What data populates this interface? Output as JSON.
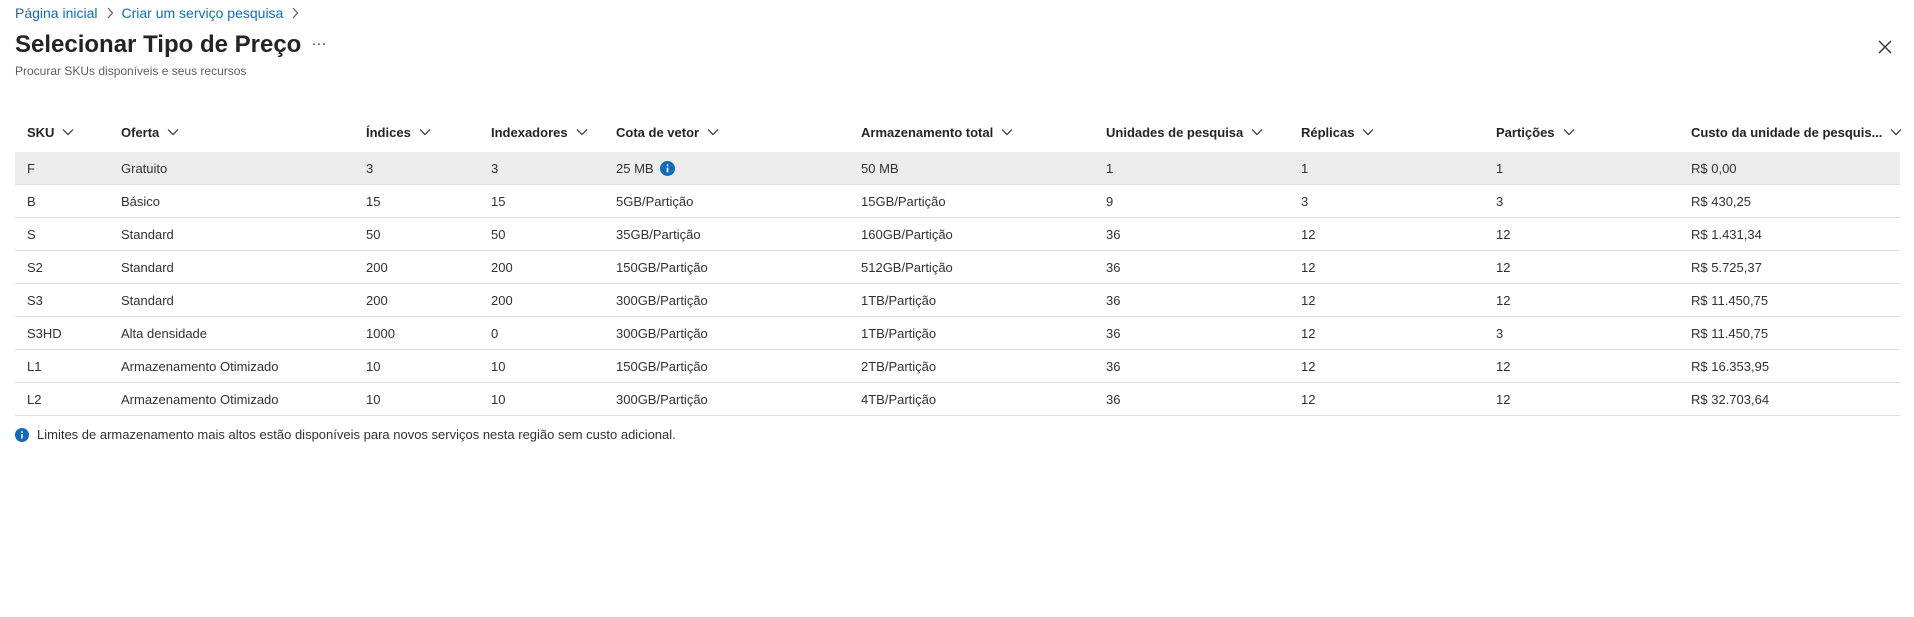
{
  "breadcrumb": {
    "items": [
      "Página inicial",
      "Criar um serviço pesquisa"
    ]
  },
  "header": {
    "title": "Selecionar Tipo de Preço",
    "more": "···",
    "subtitle": "Procurar SKUs disponíveis e seus recursos"
  },
  "table": {
    "columns": [
      "SKU",
      "Oferta",
      "Índices",
      "Indexadores",
      "Cota de vetor",
      "Armazenamento total",
      "Unidades de pesquisa",
      "Réplicas",
      "Partições",
      "Custo da unidade de pesquis..."
    ],
    "rows": [
      [
        "F",
        "Gratuito",
        "3",
        "3",
        "25 MB",
        "50 MB",
        "1",
        "1",
        "1",
        "R$ 0,00"
      ],
      [
        "B",
        "Básico",
        "15",
        "15",
        "5GB/Partição",
        "15GB/Partição",
        "9",
        "3",
        "3",
        "R$ 430,25"
      ],
      [
        "S",
        "Standard",
        "50",
        "50",
        "35GB/Partição",
        "160GB/Partição",
        "36",
        "12",
        "12",
        "R$ 1.431,34"
      ],
      [
        "S2",
        "Standard",
        "200",
        "200",
        "150GB/Partição",
        "512GB/Partição",
        "36",
        "12",
        "12",
        "R$ 5.725,37"
      ],
      [
        "S3",
        "Standard",
        "200",
        "200",
        "300GB/Partição",
        "1TB/Partição",
        "36",
        "12",
        "12",
        "R$ 11.450,75"
      ],
      [
        "S3HD",
        "Alta densidade",
        "1000",
        "0",
        "300GB/Partição",
        "1TB/Partição",
        "36",
        "12",
        "3",
        "R$ 11.450,75"
      ],
      [
        "L1",
        "Armazenamento Otimizado",
        "10",
        "10",
        "150GB/Partição",
        "2TB/Partição",
        "36",
        "12",
        "12",
        "R$ 16.353,95"
      ],
      [
        "L2",
        "Armazenamento Otimizado",
        "10",
        "10",
        "300GB/Partição",
        "4TB/Partição",
        "36",
        "12",
        "12",
        "R$ 32.703,64"
      ]
    ],
    "selected_row": 0
  },
  "footer": {
    "note": "Limites de armazenamento mais altos estão disponíveis para novos serviços nesta região sem custo adicional."
  },
  "icons": {
    "crumb_separator": "chevron-right-icon",
    "close": "close-icon",
    "sort": "chevron-down-icon",
    "info": "info-icon"
  },
  "colors": {
    "link": "#0f6cbd",
    "info": "#0f6cbd",
    "selected_row": "#ececec",
    "divider": "#e1dfdd"
  }
}
